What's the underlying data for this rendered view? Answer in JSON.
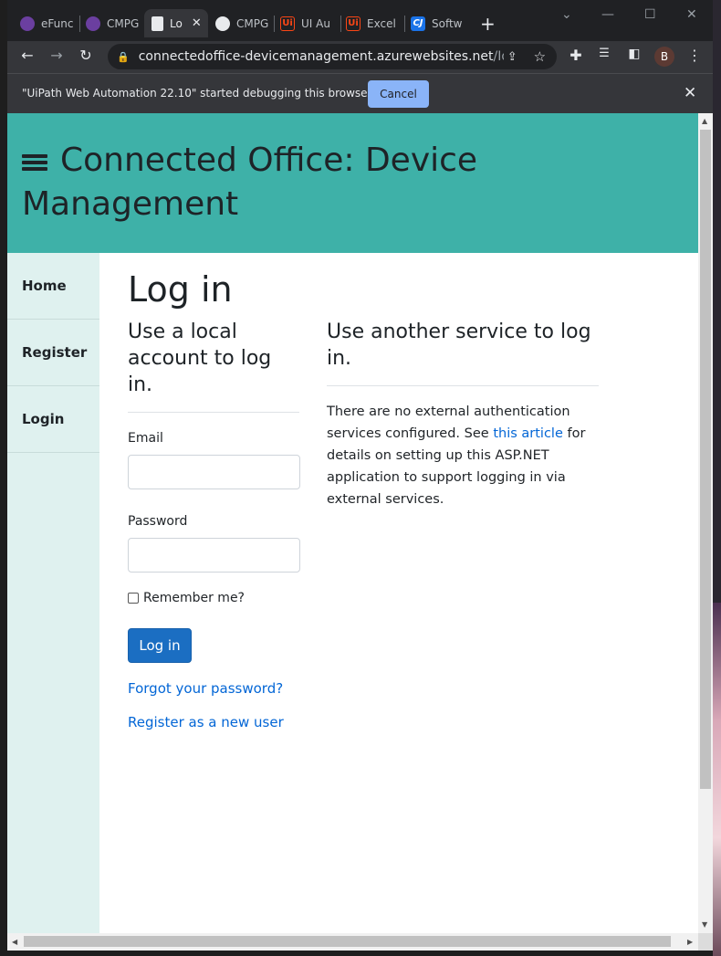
{
  "tabs": [
    {
      "label": "eFunc",
      "icon": "teams-icon"
    },
    {
      "label": "CMPG",
      "icon": "teams-icon"
    },
    {
      "label": "Lo",
      "icon": "page-icon",
      "active": true
    },
    {
      "label": "CMPG",
      "icon": "github-icon"
    },
    {
      "label": "UI Au",
      "icon": "uipath-icon"
    },
    {
      "label": "Excel",
      "icon": "uipath-icon"
    },
    {
      "label": "Softw",
      "icon": "cj-icon"
    }
  ],
  "new_tab_glyph": "+",
  "close_glyph": "✕",
  "url_host": "connectedoffice-devicemanagement.azurewebsites.net",
  "url_path": "/Identi...",
  "profile_initial": "B",
  "infobar": {
    "message": "\"UiPath Web Automation 22.10\" started debugging this browser",
    "cancel_label": "Cancel"
  },
  "site": {
    "title": "Connected Office: Device Management"
  },
  "sidebar": {
    "items": [
      {
        "label": "Home"
      },
      {
        "label": "Register"
      },
      {
        "label": "Login"
      }
    ]
  },
  "login": {
    "heading": "Log in",
    "local_heading": "Use a local account to log in.",
    "email_label": "Email",
    "password_label": "Password",
    "remember_label": "Remember me?",
    "submit_label": "Log in",
    "forgot_link": "Forgot your password?",
    "register_link": "Register as a new user"
  },
  "external": {
    "heading": "Use another service to log in.",
    "text_before": "There are no external authentication services configured. See ",
    "link_text": "this article",
    "text_after": " for details on setting up this ASP.NET application to support logging in via external services."
  },
  "colors": {
    "banner": "#3eb1a8",
    "sidebar": "#dff1ef",
    "primary_button": "#1b6ec2",
    "link": "#0366d6"
  }
}
